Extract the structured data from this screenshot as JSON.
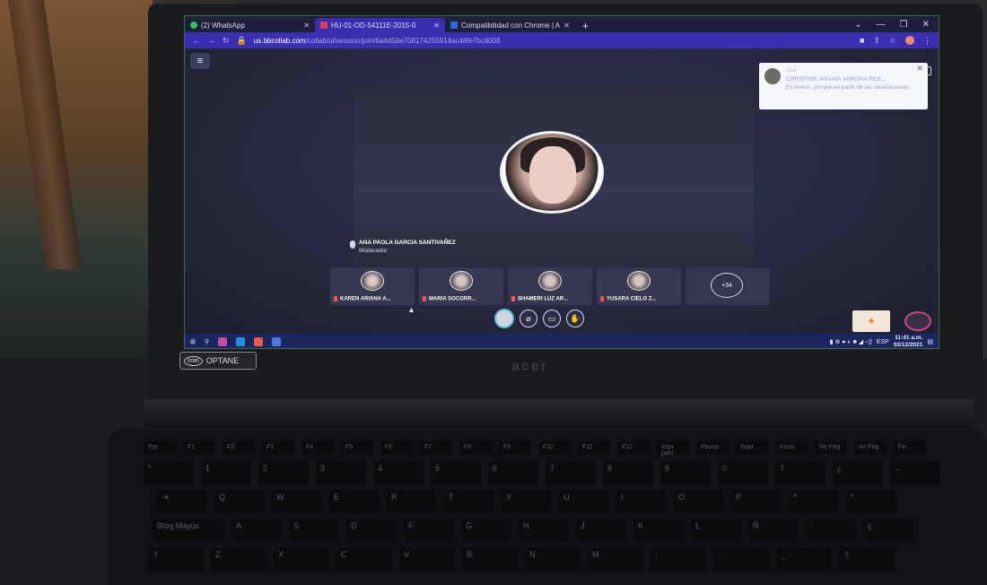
{
  "browser": {
    "tabs": [
      {
        "label": "(2) WhatsApp",
        "icon": "whatsapp-icon"
      },
      {
        "label": "HU-01-OD-54111E-2015-0",
        "icon": "blackboard-icon",
        "active": true
      },
      {
        "label": "Compatibilidad con Chrome | A",
        "icon": "compat-icon"
      }
    ],
    "url_host": "us.bbcollab.com",
    "url_path": "/collab/ui/session/join/6a4d58e708174255914ac48fe7bc8008",
    "window_controls": [
      "⌄",
      "—",
      "❐",
      "✕"
    ]
  },
  "session": {
    "speaker_name": "ANA PAOLA GARCIA SANTIVAÑEZ",
    "speaker_role": "Moderador",
    "notification": {
      "label": "Chat",
      "name": "CHRISTHIE ARAXIA VARONA REB...",
      "message": "Es bueno, porque es parte de las vacunaciones"
    },
    "participants": [
      {
        "name": "KAREN ARIANA A..."
      },
      {
        "name": "MARIA SOCORR..."
      },
      {
        "name": "SHAMERI LUZ AR..."
      },
      {
        "name": "YUSARA CIELO Z..."
      }
    ],
    "more_count": "+34"
  },
  "taskbar": {
    "tray_language": "ESP",
    "time": "11:41 a.m.",
    "date": "02/12/2021"
  },
  "hardware": {
    "brand": "acer",
    "optane_label": "OPTANE",
    "intel_label": "intel"
  },
  "keyboard": {
    "fn_row": [
      "Esc",
      "F1",
      "F2",
      "F3",
      "F4",
      "F5",
      "F6",
      "F7",
      "F8",
      "F9",
      "F10",
      "F11",
      "F12",
      "Impr pant",
      "Pausa",
      "Supr",
      "Inicio",
      "Re Pág",
      "Av Pág",
      "Fin"
    ],
    "row1": [
      "º",
      "1",
      "2",
      "3",
      "4",
      "5",
      "6",
      "7",
      "8",
      "9",
      "0",
      "?",
      "¿",
      "←"
    ],
    "row2": [
      "⇥",
      "Q",
      "W",
      "E",
      "R",
      "T",
      "Y",
      "U",
      "I",
      "O",
      "P",
      "^",
      "*"
    ],
    "row3": [
      "Bloq Mayús",
      "A",
      "S",
      "D",
      "F",
      "G",
      "H",
      "J",
      "K",
      "L",
      "Ñ",
      "¨",
      "ç"
    ],
    "row4": [
      "⇧",
      "Z",
      "X",
      "C",
      "V",
      "B",
      "N",
      "M",
      ";",
      ":",
      "_",
      "⇧"
    ]
  }
}
